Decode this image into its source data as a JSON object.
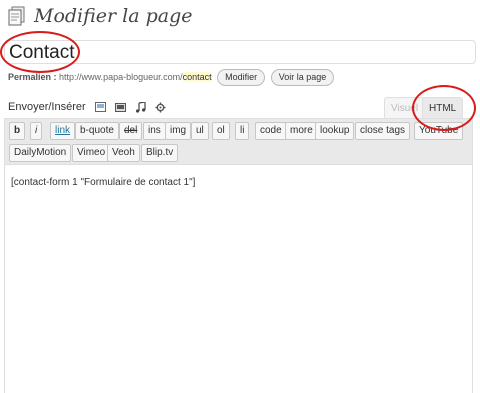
{
  "header": {
    "title": "Modifier la page",
    "icon": "pages-icon"
  },
  "title_field": {
    "value": "Contact"
  },
  "permalink": {
    "label": "Permalien :",
    "base_url": "http://www.papa-blogueur.com/",
    "slug": "contact",
    "edit_label": "Modifier",
    "view_label": "Voir la page"
  },
  "media": {
    "label": "Envoyer/Insérer",
    "icons": [
      "image-icon",
      "video-icon",
      "audio-icon",
      "media-gear-icon"
    ]
  },
  "editor_tabs": {
    "visual": "Visuel",
    "html": "HTML",
    "active": "HTML"
  },
  "quicktags": {
    "row1": [
      "b",
      "i",
      "link",
      "b-quote",
      "del",
      "ins",
      "img",
      "ul",
      "ol",
      "li",
      "code",
      "more",
      "lookup",
      "close tags",
      "YouTube"
    ],
    "row2": [
      "DailyMotion",
      "Vimeo",
      "Veoh",
      "Blip.tv"
    ]
  },
  "editor_content": "[contact-form 1 \"Formulaire de contact 1\"]",
  "colors": {
    "annotation": "#d81b1b",
    "link": "#21759b",
    "slug_highlight": "#fffbcc"
  }
}
